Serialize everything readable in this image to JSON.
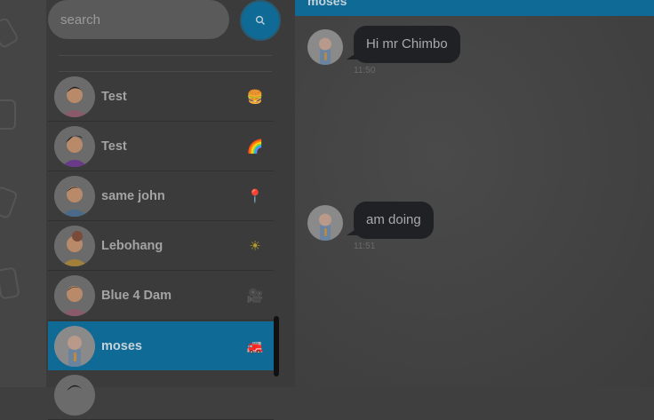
{
  "search": {
    "placeholder": "search"
  },
  "contacts": [
    {
      "name": "Test",
      "emoji": "🍔",
      "active": false
    },
    {
      "name": "Test",
      "emoji": "🌈",
      "active": false
    },
    {
      "name": "same john",
      "emoji": "📍",
      "active": false
    },
    {
      "name": "Lebohang",
      "emoji": "☀",
      "active": false
    },
    {
      "name": "Blue 4 Dam",
      "emoji": "🎥",
      "active": false
    },
    {
      "name": "moses",
      "emoji": "🚒",
      "active": true
    }
  ],
  "chat": {
    "title": "moses",
    "messages": [
      {
        "text": "Hi mr Chimbo",
        "time": "11:50"
      },
      {
        "text": "am doing",
        "time": "11:51"
      }
    ]
  },
  "colors": {
    "accent": "#0f6a96",
    "bubble": "#1f2124"
  },
  "icons": {
    "search": "search-icon"
  }
}
